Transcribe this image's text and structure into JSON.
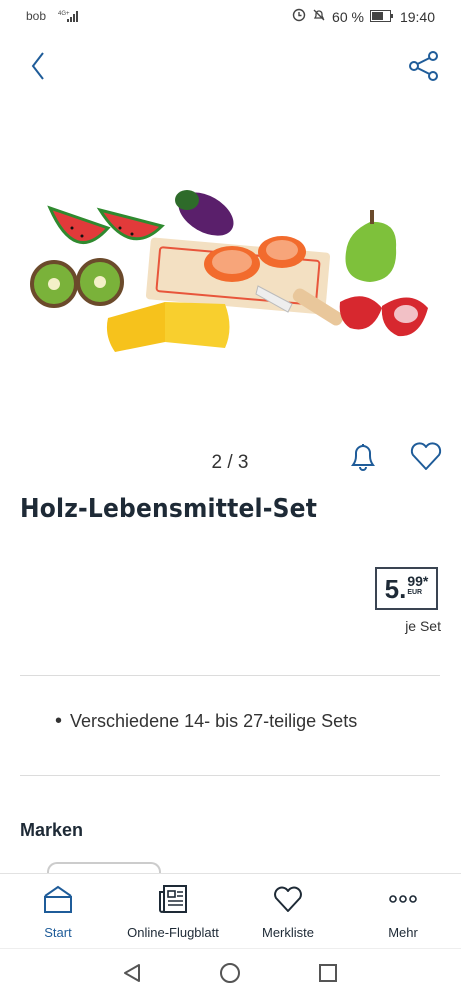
{
  "status_bar": {
    "carrier": "bob",
    "network": "4G+",
    "battery": "60 %",
    "time": "19:40"
  },
  "header": {
    "back_icon": "chevron-left-icon",
    "share_icon": "share-icon"
  },
  "gallery": {
    "pager": "2 / 3"
  },
  "product": {
    "title": "Holz-Lebensmittel-Set",
    "price_main": "5.",
    "price_cents": "99",
    "price_star": "*",
    "currency": "EUR",
    "unit": "je Set",
    "features": [
      "Verschiedene 14- bis 27-teilige Sets"
    ]
  },
  "brands": {
    "heading": "Marken"
  },
  "bottom_nav": {
    "items": [
      {
        "label": "Start",
        "icon": "home-icon",
        "active": true
      },
      {
        "label": "Online-Flugblatt",
        "icon": "flyer-icon",
        "active": false
      },
      {
        "label": "Merkliste",
        "icon": "heart-icon",
        "active": false
      },
      {
        "label": "Mehr",
        "icon": "more-icon",
        "active": false
      }
    ]
  },
  "colors": {
    "accent": "#1f5c99",
    "text": "#1e2a36"
  }
}
